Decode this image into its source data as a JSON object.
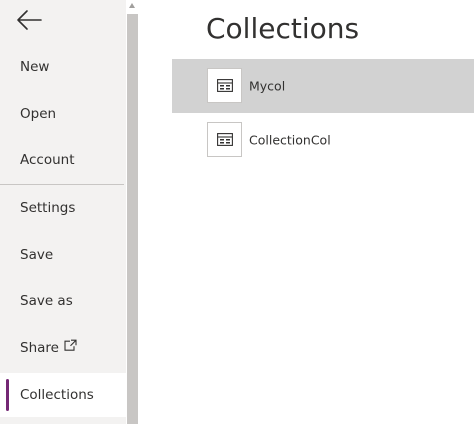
{
  "sidebar": {
    "back_icon": "back-arrow-icon",
    "items": [
      {
        "label": "New"
      },
      {
        "label": "Open"
      },
      {
        "label": "Account"
      },
      {
        "label": "Settings"
      },
      {
        "label": "Save"
      },
      {
        "label": "Save as"
      },
      {
        "label": "Share",
        "icon": "external-share-icon"
      },
      {
        "label": "Collections",
        "active": true
      }
    ],
    "active_color": "#742774"
  },
  "main": {
    "title": "Collections",
    "collections": [
      {
        "name": "Mycol",
        "icon": "collection-table-icon",
        "selected": true
      },
      {
        "name": "CollectionCol",
        "icon": "collection-table-icon",
        "selected": false
      }
    ]
  }
}
